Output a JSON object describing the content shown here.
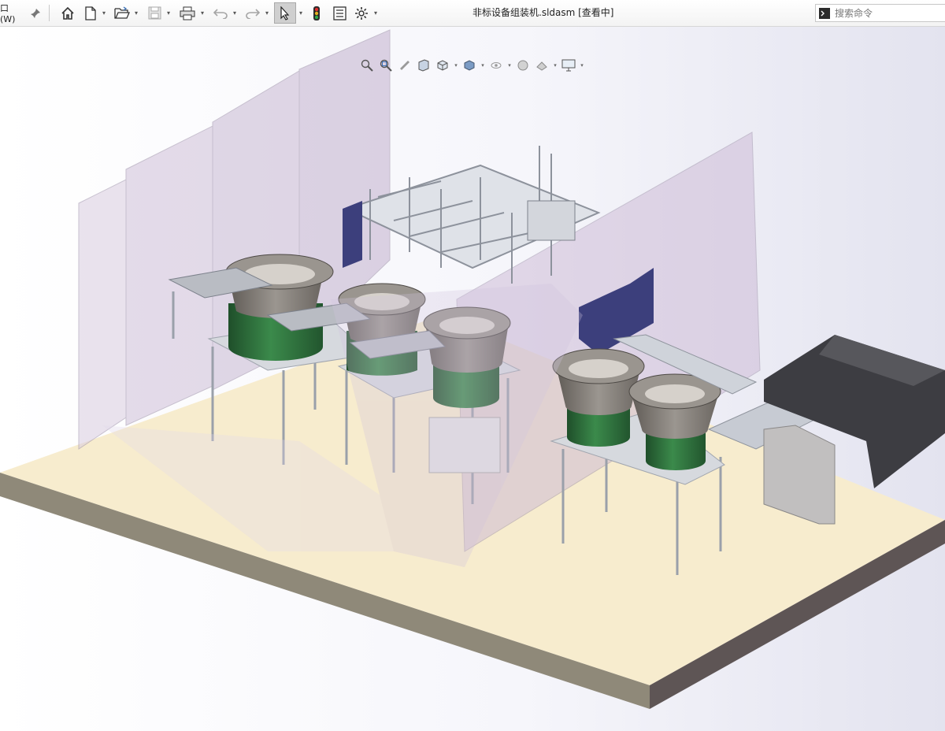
{
  "window_menu_label": "口(W)",
  "document_title": "非标设备组装机.sldasm [查看中]",
  "search": {
    "placeholder": "搜索命令"
  },
  "toolbar_icons": [
    "pin-icon",
    "home-icon",
    "new-document-icon",
    "open-folder-icon",
    "save-icon",
    "print-icon",
    "undo-icon",
    "redo-icon",
    "select-cursor-icon",
    "traffic-light-icon",
    "file-properties-icon",
    "options-gear-icon"
  ],
  "heads_up_icons": [
    "zoom-to-fit-icon",
    "zoom-to-area-icon",
    "previous-view-icon",
    "section-view-icon",
    "view-orientation-icon",
    "display-style-icon",
    "hide-show-items-icon",
    "edit-appearance-icon",
    "apply-scene-icon",
    "view-settings-icon"
  ],
  "colors": {
    "floor_top": "#f7ecce",
    "floor_front": "#8f8979",
    "floor_side": "#5e5555",
    "glass_panel": "#cdbbd6",
    "bowl_green": "#2e6e3b",
    "bowl_gray": "#7d7872",
    "hopper": "#3d3d42",
    "motor_blue": "#3c3f7c",
    "frame_aluminum": "#c4c8d0",
    "selected_tool_bg": "#cfcfcf"
  }
}
